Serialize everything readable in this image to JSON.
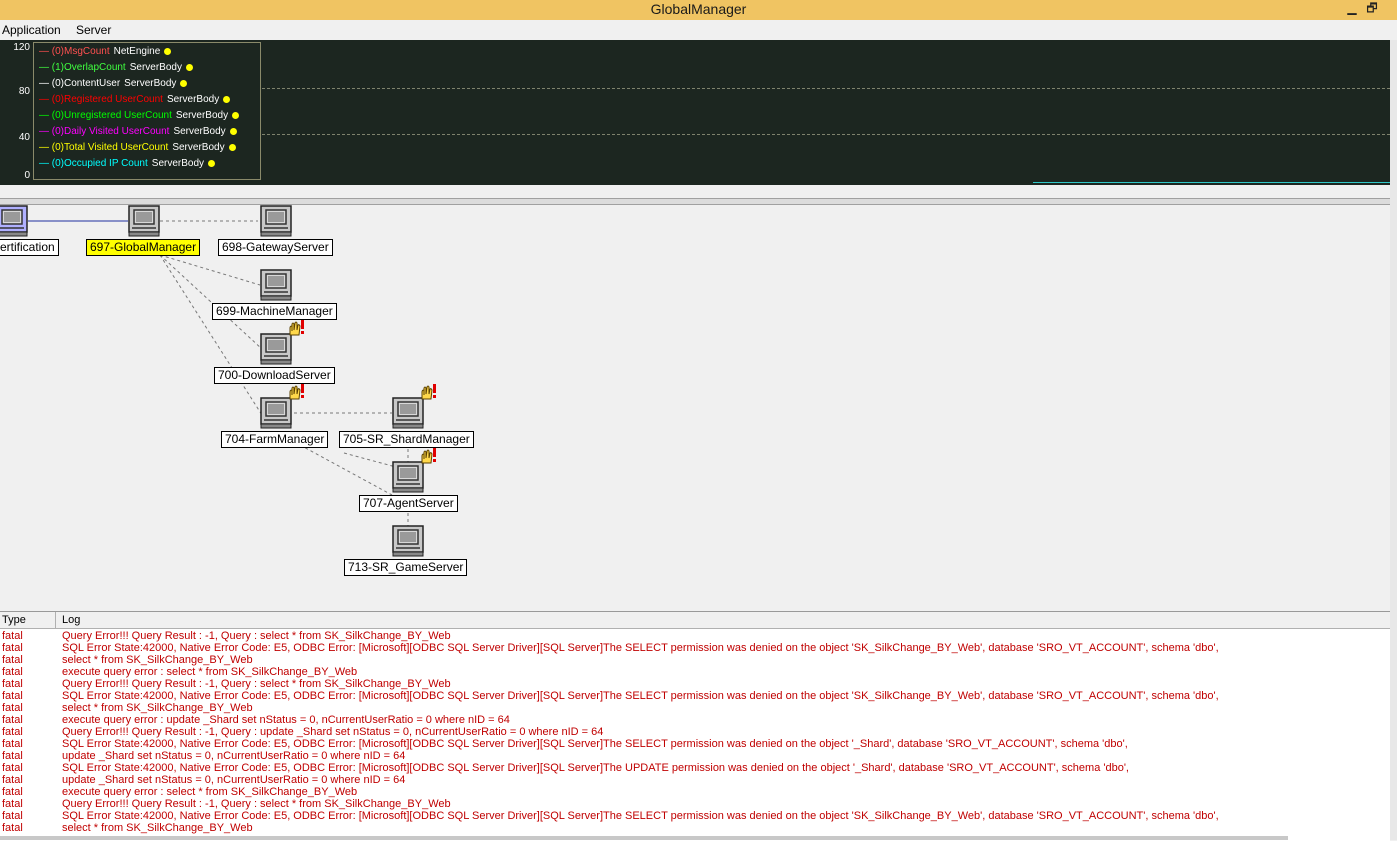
{
  "window": {
    "title": "GlobalManager",
    "minimize_label": "▁",
    "restore_label": "🗗"
  },
  "menu": {
    "items": [
      "Application",
      "Server"
    ]
  },
  "graph": {
    "y_ticks": [
      "120",
      "80",
      "40",
      "0"
    ],
    "legend": [
      {
        "count": "(0)",
        "label": "MsgCount",
        "source": "NetEngine",
        "color": "#ff5050"
      },
      {
        "count": "(1)",
        "label": "OverlapCount",
        "source": "ServerBody",
        "color": "#40ff40"
      },
      {
        "count": "(0)",
        "label": "ContentUser",
        "source": "ServerBody",
        "color": "#ffffff"
      },
      {
        "count": "(0)",
        "label": "Registered UserCount",
        "source": "ServerBody",
        "color": "#ff0000"
      },
      {
        "count": "(0)",
        "label": "Unregistered UserCount",
        "source": "ServerBody",
        "color": "#00ff00"
      },
      {
        "count": "(0)",
        "label": "Daily Visited UserCount",
        "source": "ServerBody",
        "color": "#ff00ff"
      },
      {
        "count": "(0)",
        "label": "Total Visited UserCount",
        "source": "ServerBody",
        "color": "#ffff00"
      },
      {
        "count": "(0)",
        "label": "Occupied IP Count",
        "source": "ServerBody",
        "color": "#00ffff"
      }
    ]
  },
  "topology": {
    "nodes": [
      {
        "id": "cert",
        "label": "ertification",
        "selected": false,
        "alert": false,
        "icon_color": "#b0b0ff"
      },
      {
        "id": "gm",
        "label": "697-GlobalManager",
        "selected": true,
        "alert": false,
        "icon_color": "#c8c8c8"
      },
      {
        "id": "gw",
        "label": "698-GatewayServer",
        "selected": false,
        "alert": false,
        "icon_color": "#c8c8c8"
      },
      {
        "id": "mm",
        "label": "699-MachineManager",
        "selected": false,
        "alert": false,
        "icon_color": "#c8c8c8"
      },
      {
        "id": "dl",
        "label": "700-DownloadServer",
        "selected": false,
        "alert": true,
        "icon_color": "#c8c8c8"
      },
      {
        "id": "fm",
        "label": "704-FarmManager",
        "selected": false,
        "alert": true,
        "icon_color": "#c8c8c8"
      },
      {
        "id": "sm",
        "label": "705-SR_ShardManager",
        "selected": false,
        "alert": true,
        "icon_color": "#c8c8c8"
      },
      {
        "id": "ag",
        "label": "707-AgentServer",
        "selected": false,
        "alert": true,
        "icon_color": "#c8c8c8"
      },
      {
        "id": "gs",
        "label": "713-SR_GameServer",
        "selected": false,
        "alert": false,
        "icon_color": "#c8c8c8"
      }
    ]
  },
  "log": {
    "columns": {
      "type": "Type",
      "log": "Log"
    },
    "rows": [
      {
        "type": "fatal",
        "msg": "Query Error!!! Query Result : -1, Query : select * from SK_SilkChange_BY_Web"
      },
      {
        "type": "fatal",
        "msg": "SQL Error State:42000, Native Error Code: E5, ODBC Error: [Microsoft][ODBC SQL Server Driver][SQL Server]The SELECT permission was denied on the object 'SK_SilkChange_BY_Web', database 'SRO_VT_ACCOUNT', schema 'dbo',"
      },
      {
        "type": "fatal",
        "msg": "select * from SK_SilkChange_BY_Web"
      },
      {
        "type": "fatal",
        "msg": "execute query error : select * from SK_SilkChange_BY_Web"
      },
      {
        "type": "fatal",
        "msg": "Query Error!!! Query Result : -1, Query : select * from SK_SilkChange_BY_Web"
      },
      {
        "type": "fatal",
        "msg": "SQL Error State:42000, Native Error Code: E5, ODBC Error: [Microsoft][ODBC SQL Server Driver][SQL Server]The SELECT permission was denied on the object 'SK_SilkChange_BY_Web', database 'SRO_VT_ACCOUNT', schema 'dbo',"
      },
      {
        "type": "fatal",
        "msg": "select * from SK_SilkChange_BY_Web"
      },
      {
        "type": "fatal",
        "msg": "execute query error : update _Shard set nStatus = 0, nCurrentUserRatio = 0 where nID = 64"
      },
      {
        "type": "fatal",
        "msg": "Query Error!!! Query Result : -1, Query : update _Shard set nStatus = 0, nCurrentUserRatio = 0 where nID = 64"
      },
      {
        "type": "fatal",
        "msg": "SQL Error State:42000, Native Error Code: E5, ODBC Error: [Microsoft][ODBC SQL Server Driver][SQL Server]The SELECT permission was denied on the object '_Shard', database 'SRO_VT_ACCOUNT', schema 'dbo',"
      },
      {
        "type": "fatal",
        "msg": "update _Shard set nStatus = 0, nCurrentUserRatio = 0 where nID = 64"
      },
      {
        "type": "fatal",
        "msg": "SQL Error State:42000, Native Error Code: E5, ODBC Error: [Microsoft][ODBC SQL Server Driver][SQL Server]The UPDATE permission was denied on the object '_Shard', database 'SRO_VT_ACCOUNT', schema 'dbo',"
      },
      {
        "type": "fatal",
        "msg": "update _Shard set nStatus = 0, nCurrentUserRatio = 0 where nID = 64"
      },
      {
        "type": "fatal",
        "msg": "execute query error : select * from SK_SilkChange_BY_Web"
      },
      {
        "type": "fatal",
        "msg": "Query Error!!! Query Result : -1, Query : select * from SK_SilkChange_BY_Web"
      },
      {
        "type": "fatal",
        "msg": "SQL Error State:42000, Native Error Code: E5, ODBC Error: [Microsoft][ODBC SQL Server Driver][SQL Server]The SELECT permission was denied on the object 'SK_SilkChange_BY_Web', database 'SRO_VT_ACCOUNT', schema 'dbo',"
      },
      {
        "type": "fatal",
        "msg": "select * from SK_SilkChange_BY_Web"
      }
    ]
  }
}
